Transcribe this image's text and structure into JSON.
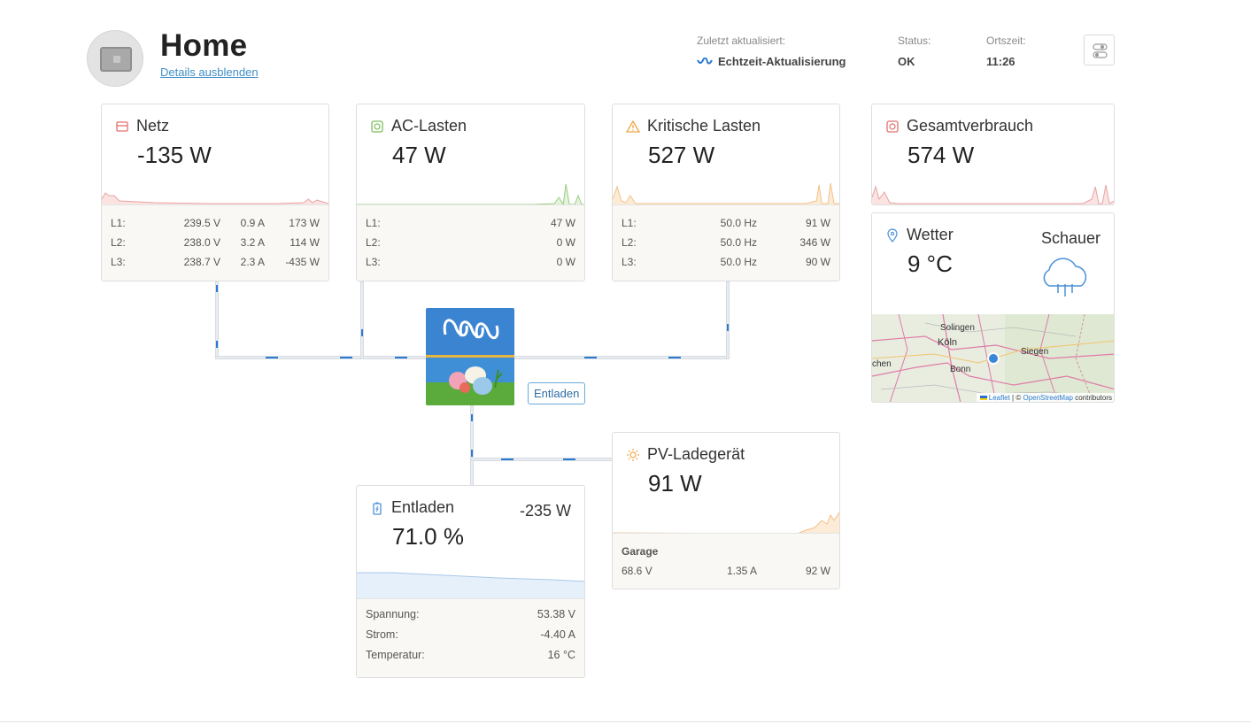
{
  "header": {
    "title": "Home",
    "details_link": "Details ausblenden",
    "last_updated_label": "Zuletzt aktualisiert:",
    "last_updated_value": "Echtzeit-Aktualisierung",
    "status_label": "Status:",
    "status_value": "OK",
    "local_time_label": "Ortszeit:",
    "local_time_value": "11:26"
  },
  "grid": {
    "title": "Netz",
    "value": "-135 W",
    "rows": [
      {
        "label": "L1:",
        "voltage": "239.5 V",
        "current": "0.9 A",
        "power": "173 W"
      },
      {
        "label": "L2:",
        "voltage": "238.0 V",
        "current": "3.2 A",
        "power": "114 W"
      },
      {
        "label": "L3:",
        "voltage": "238.7 V",
        "current": "2.3 A",
        "power": "-435 W"
      }
    ]
  },
  "ac_loads": {
    "title": "AC-Lasten",
    "value": "47 W",
    "rows": [
      {
        "label": "L1:",
        "power": "47 W"
      },
      {
        "label": "L2:",
        "power": "0 W"
      },
      {
        "label": "L3:",
        "power": "0 W"
      }
    ]
  },
  "critical_loads": {
    "title": "Kritische Lasten",
    "value": "527 W",
    "rows": [
      {
        "label": "L1:",
        "freq": "50.0 Hz",
        "power": "91 W"
      },
      {
        "label": "L2:",
        "freq": "50.0 Hz",
        "power": "346 W"
      },
      {
        "label": "L3:",
        "freq": "50.0 Hz",
        "power": "90 W"
      }
    ]
  },
  "total": {
    "title": "Gesamtverbrauch",
    "value": "574 W"
  },
  "weather": {
    "title": "Wetter",
    "condition": "Schauer",
    "temp": "9 °C",
    "map": {
      "city1": "Solingen",
      "city2": "Köln",
      "city3": "Siegen",
      "city4": "Bonn",
      "city5": "chen",
      "attribution_leaflet": "Leaflet",
      "attribution_sep": "| ©",
      "attribution_osm": "OpenStreetMap",
      "attribution_tail": "contributors"
    }
  },
  "inverter_tag": "Entladen",
  "battery": {
    "title": "Entladen",
    "power": "-235 W",
    "soc": "71.0 %",
    "rows": [
      {
        "label": "Spannung:",
        "value": "53.38 V"
      },
      {
        "label": "Strom:",
        "value": "-4.40 A"
      },
      {
        "label": "Temperatur:",
        "value": "16 °C"
      }
    ]
  },
  "pv": {
    "title": "PV-Ladegerät",
    "value": "91 W",
    "name": "Garage",
    "voltage": "68.6 V",
    "current": "1.35 A",
    "power": "92 W"
  },
  "colors": {
    "grid": "#e0706e",
    "ac": "#7cbd5a",
    "critical": "#f0a646",
    "total": "#e0706e",
    "battery": "#4a90d9",
    "pv": "#f0a646",
    "flow": "#2d7bd0"
  }
}
